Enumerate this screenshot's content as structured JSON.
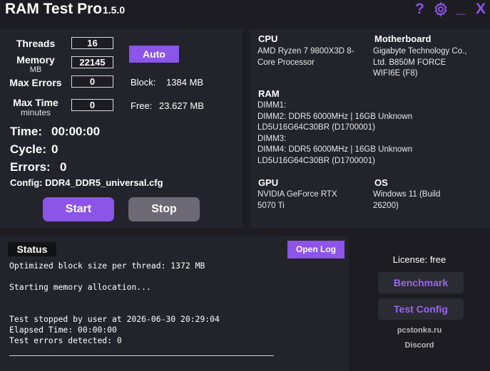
{
  "app": {
    "title": "RAM Test Pro",
    "version": "1.5.0",
    "help_glyph": "?",
    "minimize_glyph": "_",
    "close_glyph": "X"
  },
  "settings": {
    "threads_label": "Threads",
    "threads_value": "16",
    "memory_label": "Memory",
    "memory_unit": "MB",
    "memory_value": "22145",
    "max_errors_label": "Max Errors",
    "max_errors_value": "0",
    "max_time_label": "Max Time",
    "max_time_unit": "minutes",
    "max_time_value": "0",
    "auto_label": "Auto",
    "block_label": "Block:",
    "block_value": "1384 MB",
    "free_label": "Free:",
    "free_value": "23.627 MB"
  },
  "stats": {
    "time_label": "Time:",
    "time_value": "00:00:00",
    "cycle_label": "Cycle:",
    "cycle_value": "0",
    "errors_label": "Errors:",
    "errors_value": "0",
    "config_label": "Config:",
    "config_value": "DDR4_DDR5_universal.cfg"
  },
  "controls": {
    "start_label": "Start",
    "stop_label": "Stop"
  },
  "hardware": {
    "cpu_title": "CPU",
    "cpu_value": "AMD Ryzen 7 9800X3D 8-\nCore Processor",
    "motherboard_title": "Motherboard",
    "motherboard_value": "Gigabyte Technology Co.,\nLtd. B850M FORCE\nWIFI6E (F8)",
    "ram_title": "RAM",
    "ram_value": "DIMM1:\nDIMM2: DDR5 6000MHz | 16GB Unknown\nLD5U16G64C30BR (D1700001)\nDIMM3:\nDIMM4: DDR5 6000MHz | 16GB Unknown\nLD5U16G64C30BR (D1700001)",
    "gpu_title": "GPU",
    "gpu_value": "NVIDIA GeForce RTX\n5070 Ti",
    "os_title": "OS",
    "os_value": "Windows 11 (Build\n26200)"
  },
  "status": {
    "title": "Status",
    "open_log_label": "Open Log",
    "log": "Optimized block size per thread: 1372 MB\n\nStarting memory allocation...\n\n\nTest stopped by user at 2026-06-30 20:29:04\nElapsed Time: 00:00:00\nTest errors detected: 0"
  },
  "sidebar": {
    "license": "License: free",
    "benchmark_label": "Benchmark",
    "test_config_label": "Test Config",
    "site_link": "pcstonks.ru",
    "discord_link": "Discord"
  },
  "colors": {
    "accent": "#8c54e8",
    "background": "#1c1c22",
    "panel": "#23232b",
    "stop_button": "#6d6a76"
  }
}
